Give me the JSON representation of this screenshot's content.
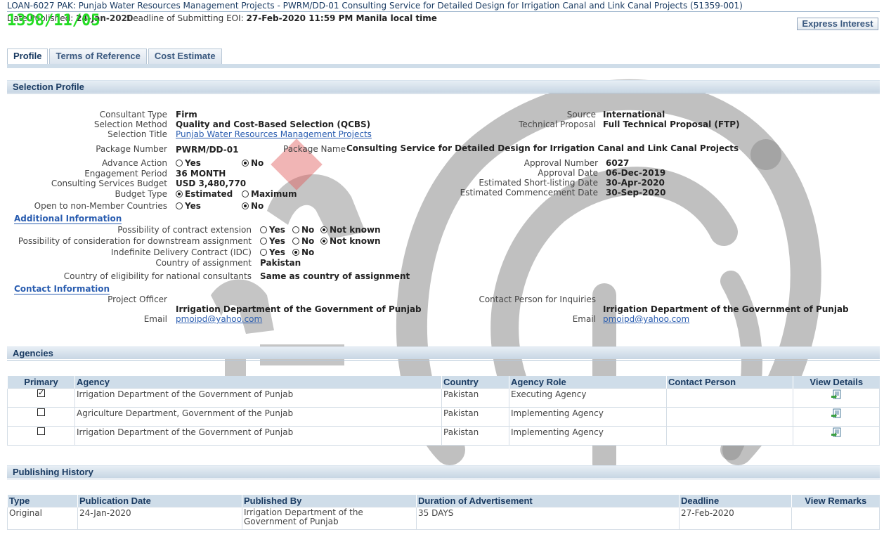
{
  "header": {
    "title": "LOAN-6027 PAK: Punjab Water Resources Management Projects - PWRM/DD-01 Consulting Service for Detailed Design for Irrigation Canal and Link Canal Projects (51359-001)",
    "date_published_label": "Date Published:",
    "date_published": "24-Jan-2020",
    "deadline_label": "Deadline of Submitting EOI:",
    "deadline": "27-Feb-2020 11:59 PM Manila local time",
    "overlay_date": "1398/11/05",
    "express_interest": "Express Interest"
  },
  "tabs": [
    "Profile",
    "Terms of Reference",
    "Cost Estimate"
  ],
  "selection_profile": {
    "heading": "Selection Profile",
    "consultant_type_label": "Consultant Type",
    "consultant_type": "Firm",
    "selection_method_label": "Selection Method",
    "selection_method": "Quality and Cost-Based Selection (QCBS)",
    "selection_title_label": "Selection Title",
    "selection_title": "Punjab Water Resources Management Projects",
    "source_label": "Source",
    "source": "International",
    "technical_proposal_label": "Technical Proposal",
    "technical_proposal": "Full Technical Proposal (FTP)",
    "package_number_label": "Package Number",
    "package_number": "PWRM/DD-01",
    "package_name_label": "Package Name",
    "package_name": "Consulting Service for Detailed Design for Irrigation Canal and Link Canal Projects",
    "advance_action_label": "Advance Action",
    "engagement_period_label": "Engagement Period",
    "engagement_period": "36 MONTH",
    "budget_label": "Consulting Services Budget",
    "budget": "USD 3,480,770",
    "budget_type_label": "Budget Type",
    "open_label": "Open to non-Member Countries",
    "approval_number_label": "Approval Number",
    "approval_number": "6027",
    "approval_date_label": "Approval Date",
    "approval_date": "06-Dec-2019",
    "shortlisting_label": "Estimated Short-listing Date",
    "shortlisting_date": "30-Apr-2020",
    "commencement_label": "Estimated Commencement Date",
    "commencement_date": "30-Sep-2020",
    "opt_yes": "Yes",
    "opt_no": "No",
    "opt_estimated": "Estimated",
    "opt_maximum": "Maximum",
    "opt_not_known": "Not known"
  },
  "additional_info": {
    "heading": "Additional Information",
    "extension_label": "Possibility of contract extension",
    "downstream_label": "Possibility of consideration for downstream assignment",
    "idc_label": "Indefinite Delivery Contract (IDC)",
    "country_label": "Country of assignment",
    "country": "Pakistan",
    "eligibility_label": "Country of eligibility for national consultants",
    "eligibility": "Same as country of assignment"
  },
  "contact_info": {
    "heading": "Contact Information",
    "project_officer_label": "Project Officer",
    "project_officer_org": "Irrigation Department of the Government of Punjab",
    "email_label": "Email",
    "email": "pmoipd@yahoo.com",
    "inquiries_label": "Contact Person for Inquiries",
    "inquiries_org": "Irrigation Department of the Government of Punjab",
    "inquiries_email": "pmoipd@yahoo.com"
  },
  "agencies": {
    "heading": "Agencies",
    "columns": [
      "Primary",
      "Agency",
      "Country",
      "Agency Role",
      "Contact Person",
      "View Details"
    ],
    "rows": [
      {
        "primary": true,
        "agency": "Irrigation Department of the Government of Punjab",
        "country": "Pakistan",
        "role": "Executing Agency",
        "contact": ""
      },
      {
        "primary": false,
        "agency": "Agriculture Department, Government of the Punjab",
        "country": "Pakistan",
        "role": "Implementing Agency",
        "contact": ""
      },
      {
        "primary": false,
        "agency": "Irrigation Department of the Government of Punjab",
        "country": "Pakistan",
        "role": "Implementing Agency",
        "contact": ""
      }
    ]
  },
  "publishing": {
    "heading": "Publishing History",
    "columns": [
      "Type",
      "Publication Date",
      "Published By",
      "Duration of Advertisement",
      "Deadline",
      "View Remarks"
    ],
    "rows": [
      {
        "type": "Original",
        "date": "24-Jan-2020",
        "by": "Irrigation Department of the Government of Punjab",
        "duration": "35 DAYS",
        "deadline": "27-Feb-2020",
        "remarks": ""
      }
    ]
  },
  "colors": {
    "section_bg": "#c7d6e4",
    "heading_text": "#1a3b62",
    "link": "#2a5db0",
    "overlay_green": "#22dd22",
    "watermark_gray": "#8c8c8c",
    "watermark_red": "#e05a5a"
  },
  "icons": [
    "view-details-icon",
    "radio-button-icon",
    "checkbox-icon",
    "watermark-logo"
  ]
}
